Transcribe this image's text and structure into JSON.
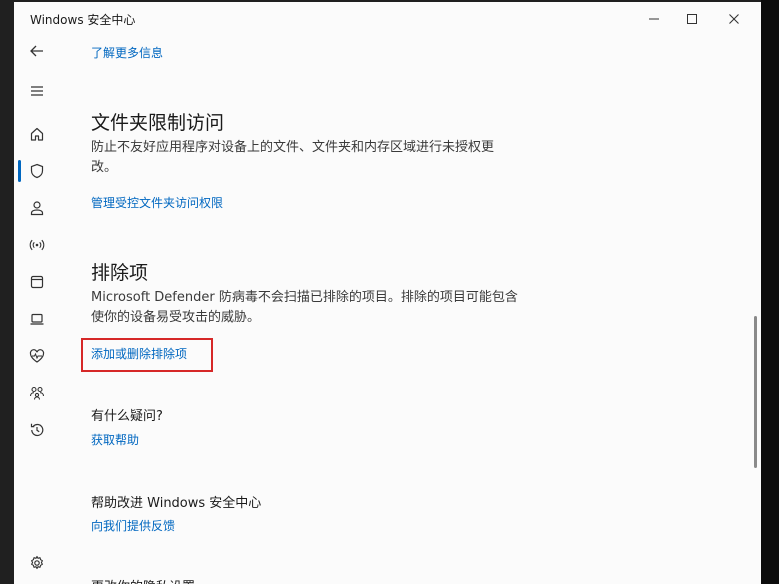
{
  "window": {
    "title": "Windows 安全中心",
    "controls": {
      "minimize": "—",
      "maximize": "☐",
      "close": "✕"
    }
  },
  "sidebar": {
    "items": [
      {
        "name": "back-arrow-icon"
      },
      {
        "name": "hamburger-menu-icon"
      },
      {
        "name": "home-icon"
      },
      {
        "name": "shield-icon",
        "active": true
      },
      {
        "name": "person-icon"
      },
      {
        "name": "wireless-antenna-icon"
      },
      {
        "name": "app-window-icon"
      },
      {
        "name": "laptop-icon"
      },
      {
        "name": "heart-pulse-icon"
      },
      {
        "name": "family-icon"
      },
      {
        "name": "history-icon"
      },
      {
        "name": "settings-gear-icon"
      }
    ]
  },
  "content": {
    "learn_more_link": "了解更多信息",
    "controlled_folder": {
      "heading": "文件夹限制访问",
      "description_line1": "防止不友好应用程序对设备上的文件、文件夹和内存区域进行未授权更",
      "description_line2": "改。",
      "manage_link": "管理受控文件夹访问权限"
    },
    "exclusions": {
      "heading": "排除项",
      "description_line1": "Microsoft Defender 防病毒不会扫描已排除的项目。排除的项目可能包含",
      "description_line2": "使你的设备易受攻击的威胁。",
      "add_remove_link": "添加或删除排除项"
    },
    "help": {
      "heading": "有什么疑问?",
      "get_help_link": "获取帮助"
    },
    "improve": {
      "heading": "帮助改进 Windows 安全中心",
      "feedback_link": "向我们提供反馈"
    },
    "privacy": {
      "heading": "更改你的隐私设置"
    }
  },
  "colors": {
    "accent": "#0067c0",
    "highlight_border": "#d62828",
    "background": "#fbfbfb"
  }
}
